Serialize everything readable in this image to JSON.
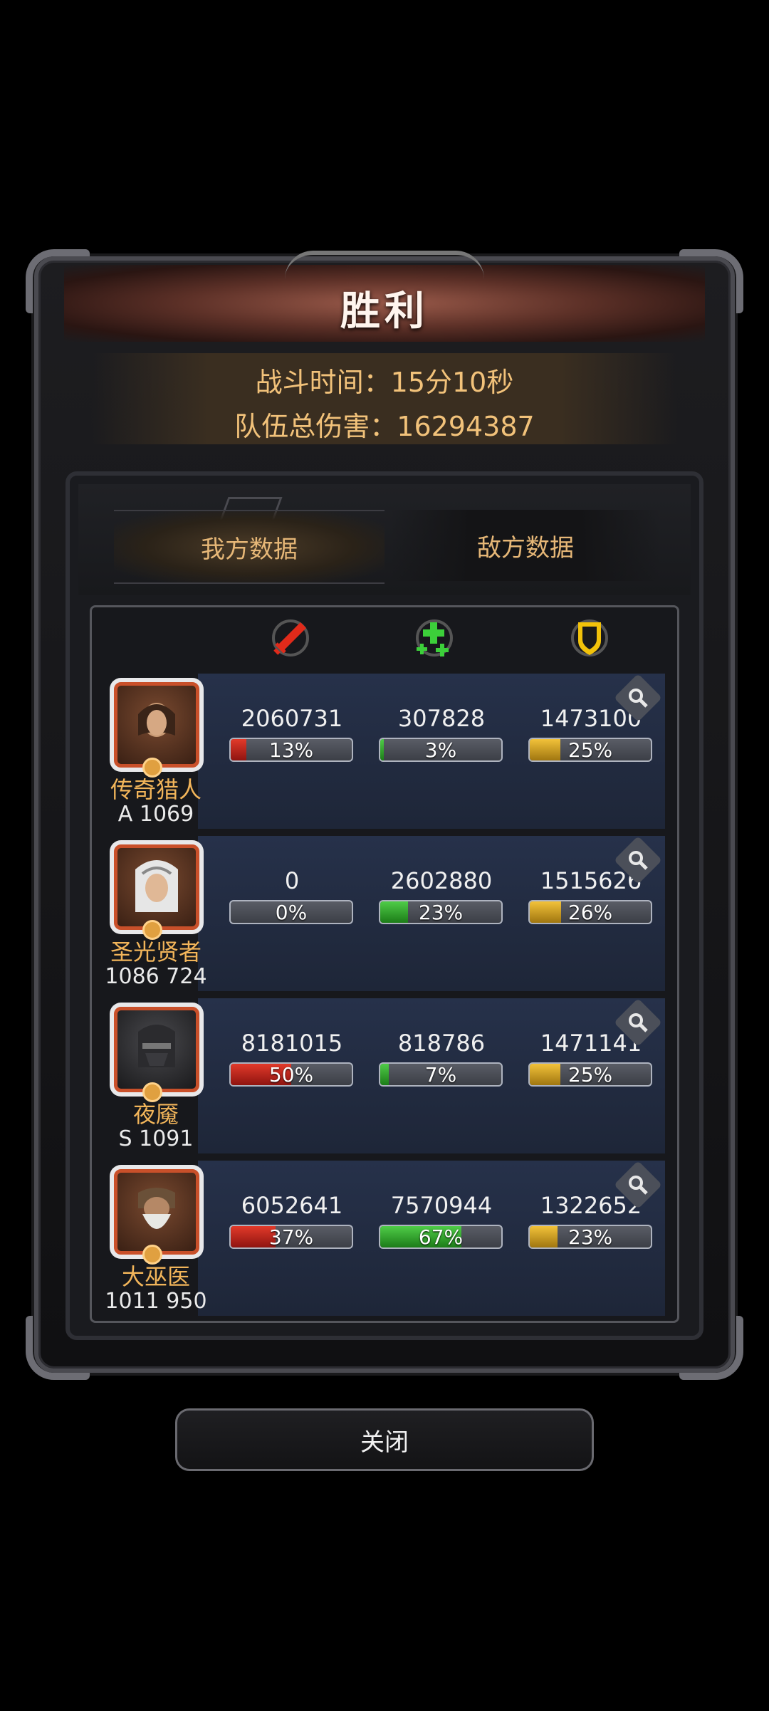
{
  "dialog": {
    "title": "胜利",
    "battle_time": "战斗时间：15分10秒",
    "team_damage": "队伍总伤害：16294387"
  },
  "tabs": [
    {
      "label": "我方数据",
      "active": true
    },
    {
      "label": "敌方数据",
      "active": false
    }
  ],
  "columns": [
    {
      "icon": "sword-icon"
    },
    {
      "icon": "heal-cross-icon"
    },
    {
      "icon": "shield-icon"
    }
  ],
  "heroes": [
    {
      "name": "传奇猎人",
      "power": "A 1069",
      "damage": "2060731",
      "damage_pct": "13%",
      "damage_fill": 0.13,
      "heal": "307828",
      "heal_pct": "3%",
      "heal_fill": 0.03,
      "tank": "1473100",
      "tank_pct": "25%",
      "tank_fill": 0.25
    },
    {
      "name": "圣光贤者",
      "power": "1086 724",
      "damage": "0",
      "damage_pct": "0%",
      "damage_fill": 0.0,
      "heal": "2602880",
      "heal_pct": "23%",
      "heal_fill": 0.23,
      "tank": "1515626",
      "tank_pct": "26%",
      "tank_fill": 0.26
    },
    {
      "name": "夜魇",
      "power": "S 1091",
      "damage": "8181015",
      "damage_pct": "50%",
      "damage_fill": 0.5,
      "heal": "818786",
      "heal_pct": "7%",
      "heal_fill": 0.07,
      "tank": "1471141",
      "tank_pct": "25%",
      "tank_fill": 0.25
    },
    {
      "name": "大巫医",
      "power": "1011 950",
      "damage": "6052641",
      "damage_pct": "37%",
      "damage_fill": 0.37,
      "heal": "7570944",
      "heal_pct": "67%",
      "heal_fill": 0.67,
      "tank": "1322652",
      "tank_pct": "23%",
      "tank_fill": 0.23
    }
  ],
  "buttons": {
    "close": "关闭"
  },
  "colors": {
    "gold_text": "#f2c27a",
    "damage_bar": "#e23a2a",
    "heal_bar": "#4fcc48",
    "tank_bar": "#f2c23a"
  }
}
